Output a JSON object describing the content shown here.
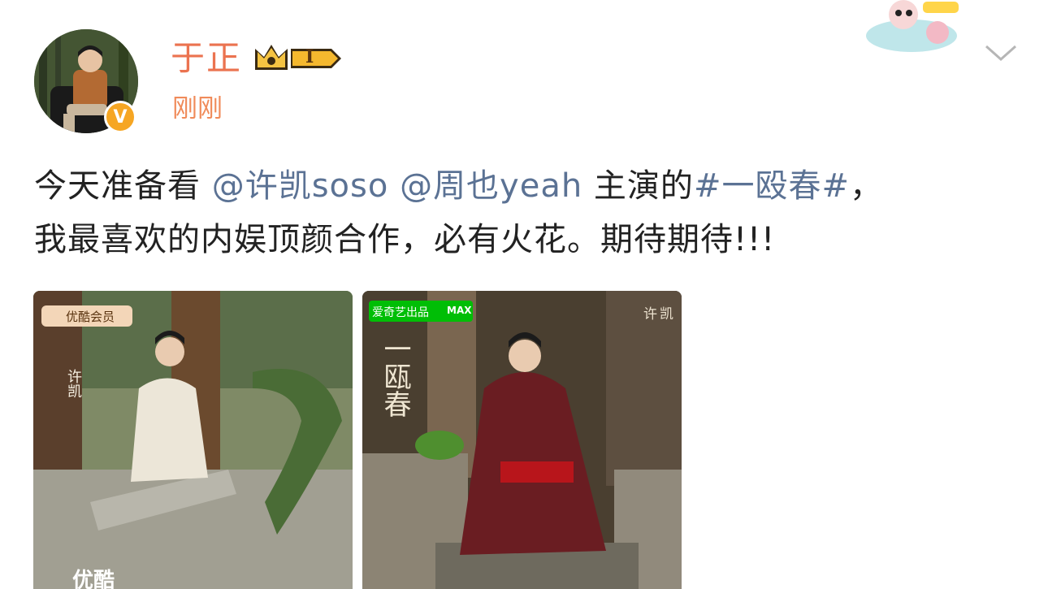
{
  "author": {
    "name": "于正",
    "level_badge": "I",
    "timestamp": "刚刚"
  },
  "post": {
    "line1": {
      "prefix": "今天准备看 ",
      "mention1": "@许凯soso",
      "mention2": "@周也yeah",
      "mid": " 主演的",
      "hashtag": "#一殴春#",
      "suffix": "，"
    },
    "line2": "我最喜欢的内娱顶颜合作，必有火花。期待期待!!!"
  },
  "images": {
    "image1": {
      "vip_badge": "优酷会员",
      "name_text": "许凯",
      "brand_text": "优酷"
    },
    "image2": {
      "producer_badge": "爱奇艺出品",
      "max_badge": "MAX",
      "name_text": "许凯",
      "title_text": "一瓯春"
    }
  },
  "colors": {
    "username": "#eb7350",
    "link": "#5b7294",
    "body_text": "#222222",
    "verified": "#f6a623",
    "iqiyi_green": "#00be06"
  },
  "icons": {
    "verified": "verified-v-icon",
    "crown": "crown-icon",
    "chevron": "chevron-down-icon"
  }
}
